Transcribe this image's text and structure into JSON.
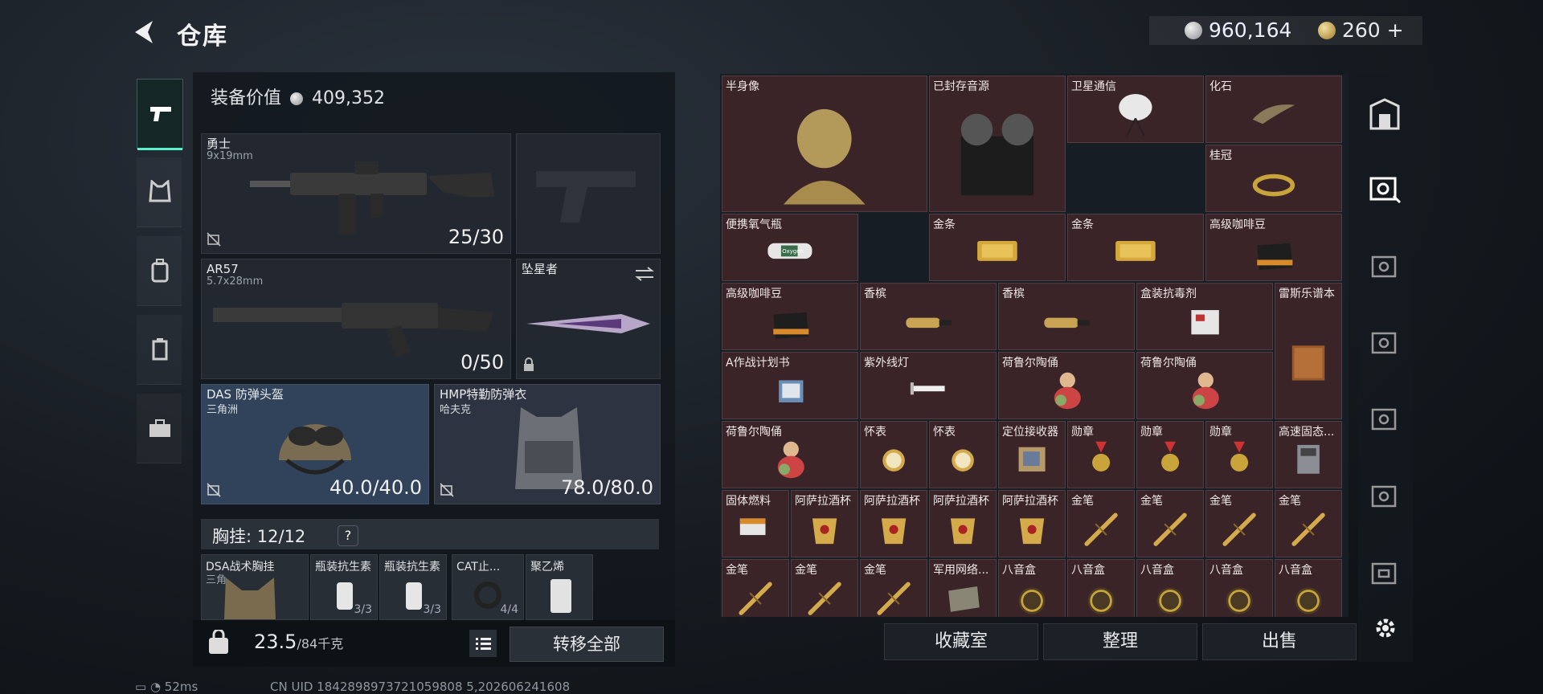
{
  "header": {
    "title": "仓库",
    "money": "960,164",
    "tokens": "260",
    "plus": "+"
  },
  "equipment": {
    "value_label": "装备价值",
    "value": "409,352",
    "primary": {
      "name": "勇士",
      "caliber": "9x19mm",
      "ammo": "25/30"
    },
    "secondary": {
      "name": "AR57",
      "caliber": "5.7x28mm",
      "ammo": "0/50"
    },
    "melee": {
      "name": "坠星者"
    },
    "helmet": {
      "name": "DAS 防弹头盔",
      "sub": "三角洲",
      "durability": "40.0/40.0"
    },
    "armor": {
      "name": "HMP特勤防弹衣",
      "sub": "哈夫克",
      "durability": "78.0/80.0"
    },
    "chest_rig": {
      "label": "胸挂:",
      "capacity": "12/12",
      "help": "?"
    },
    "rig_items": [
      {
        "name": "DSA战术胸挂",
        "sub": "三角",
        "count": ""
      },
      {
        "name": "瓶装抗生素",
        "count": "3/3"
      },
      {
        "name": "瓶装抗生素",
        "count": "3/3"
      },
      {
        "name": "CAT止...",
        "count": "4/4"
      },
      {
        "name": "聚乙烯",
        "count": ""
      }
    ],
    "weight": "23.5",
    "weight_max": "/84千克",
    "transfer_all": "转移全部"
  },
  "stash": {
    "items": [
      "半身像",
      "已封存音源",
      "卫星通信",
      "化石",
      "桂冠",
      "便携氧气瓶",
      "金条",
      "金条",
      "高级咖啡豆",
      "高级咖啡豆",
      "香槟",
      "香槟",
      "盒装抗毒剂",
      "雷斯乐谱本",
      "A作战计划书",
      "紫外线灯",
      "荷鲁尔陶俑",
      "荷鲁尔陶俑",
      "荷鲁尔陶俑",
      "怀表",
      "怀表",
      "定位接收器",
      "勋章",
      "勋章",
      "勋章",
      "高速固态...",
      "固体燃料",
      "阿萨拉酒杯",
      "阿萨拉酒杯",
      "阿萨拉酒杯",
      "阿萨拉酒杯",
      "金笔",
      "金笔",
      "金笔",
      "金笔",
      "金笔",
      "金笔",
      "金笔",
      "军用网络...",
      "八音盒",
      "八音盒",
      "八音盒",
      "八音盒",
      "八音盒"
    ],
    "oxygen_label": "Oxygen",
    "buttons": {
      "collection": "收藏室",
      "sort": "整理",
      "sell": "出售"
    }
  },
  "status": {
    "ping": "52ms",
    "uid": "CN UID 1842898973721059808 5,202606241608"
  },
  "colors": {
    "accent": "#5df0d0",
    "rare_bg": "#3a2428",
    "panel": "#12171d"
  }
}
